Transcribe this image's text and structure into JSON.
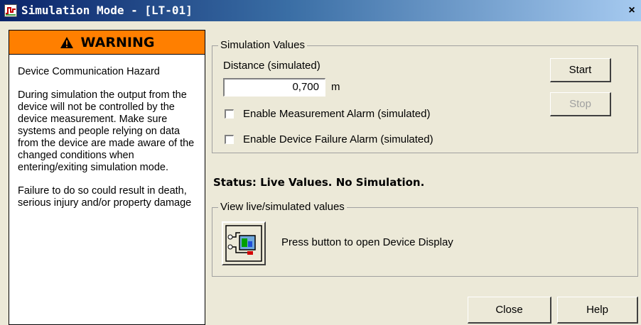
{
  "window": {
    "title": "Simulation Mode - [LT-01]",
    "close_glyph": "×"
  },
  "warning": {
    "header": "WARNING",
    "title": "Device Communication Hazard",
    "paragraph1": "During simulation the output from the device will not be controlled by the device measurement. Make sure systems and people relying on data from the device are made aware of the changed conditions when entering/exiting simulation mode.",
    "paragraph2": "Failure to do so could result in death, serious injury and/or property damage",
    "header_color": "#ff7f00"
  },
  "simulation": {
    "group_title": "Simulation Values",
    "distance_label": "Distance (simulated)",
    "distance_value": "0,700",
    "distance_unit": "m",
    "checkbox_measurement_label": "Enable Measurement Alarm (simulated)",
    "checkbox_failure_label": "Enable Device Failure Alarm (simulated)",
    "checkbox_measurement_checked": false,
    "checkbox_failure_checked": false,
    "start_label": "Start",
    "stop_label": "Stop"
  },
  "status": {
    "text": "Status: Live Values. No Simulation."
  },
  "view": {
    "group_title": "View live/simulated values",
    "device_display_text": "Press button to open Device Display",
    "icon": "device-display-icon"
  },
  "footer": {
    "close_label": "Close",
    "help_label": "Help"
  }
}
